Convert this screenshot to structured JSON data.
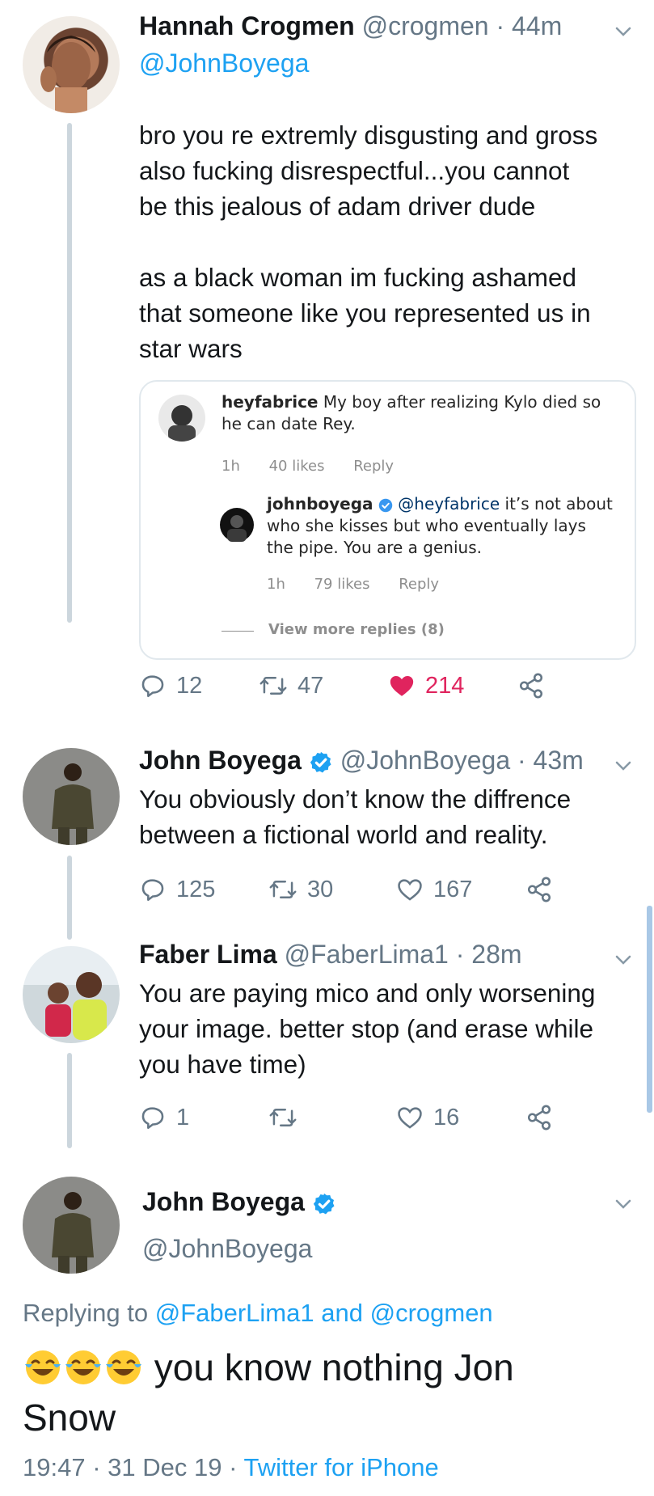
{
  "tweets": [
    {
      "name": "Hannah Crogmen",
      "handle": "@crogmen",
      "time": "44m",
      "reply_to": "@JohnBoyega",
      "body": [
        "bro you re extremly disgusting and gross",
        "also fucking disrespectful...you cannot",
        "be this jealous of adam driver dude",
        "",
        "as a black woman im fucking ashamed",
        "that someone like you represented us in",
        "star wars"
      ],
      "replies": "12",
      "retweets": "47",
      "likes": "214",
      "liked": true
    },
    {
      "name": "John Boyega",
      "handle": "@JohnBoyega",
      "time": "43m",
      "verified": true,
      "body": [
        "You obviously don’t know the diffrence",
        "between a fictional world and reality."
      ],
      "replies": "125",
      "retweets": "30",
      "likes": "167"
    },
    {
      "name": "Faber Lima",
      "handle": "@FaberLima1",
      "time": "28m",
      "body": [
        "You are paying mico and only worsening",
        "your image.  better stop (and erase while",
        "you have time)"
      ],
      "replies": "1",
      "retweets": "",
      "likes": "16"
    }
  ],
  "embedded_card": {
    "comment1": {
      "user": "heyfabrice",
      "text1": "My boy after realizing Kylo died so",
      "text2": "he can date Rey.",
      "age": "1h",
      "likes": "40 likes",
      "reply": "Reply"
    },
    "comment2": {
      "user": "johnboyega",
      "mention": "@heyfabrice",
      "text1": "it’s not about",
      "text2": "who she kisses but who eventually lays",
      "text3": "the pipe. You are a genius.",
      "age": "1h",
      "likes": "79 likes",
      "reply": "Reply"
    },
    "view_more": "View more replies (8)"
  },
  "main_tweet": {
    "name": "John Boyega",
    "handle": "@JohnBoyega",
    "replying_prefix": "Replying to",
    "replying_to_1": "@FaberLima1",
    "replying_and": "and",
    "replying_to_2": "@crogmen",
    "emoji": "😂😂😂",
    "text_line1": "you know nothing Jon",
    "text_line2": "Snow",
    "time": "19:47",
    "date": "31 Dec 19",
    "client": "Twitter for iPhone"
  },
  "colors": {
    "blue": "#1da1f2",
    "gray": "#657786",
    "like_red": "#e0245e",
    "thread": "#ccd6dd"
  }
}
